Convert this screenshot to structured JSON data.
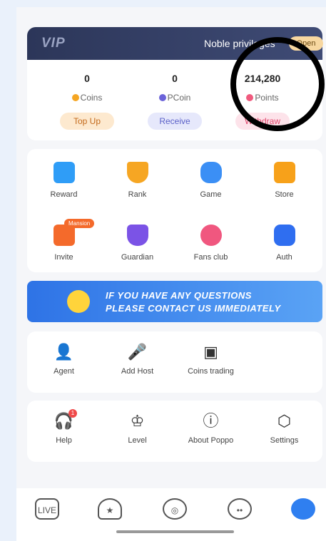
{
  "vip": {
    "logo": "VIP",
    "title": "Noble privileges",
    "open_label": "Open"
  },
  "assets": [
    {
      "value": "0",
      "label": "Coins",
      "button": "Top Up",
      "color": "#f5a623",
      "btn_bg": "#fde9cf",
      "btn_fg": "#c46a1b"
    },
    {
      "value": "0",
      "label": "PCoin",
      "button": "Receive",
      "color": "#6b63d9",
      "btn_bg": "#e6e8fb",
      "btn_fg": "#5a5fc8"
    },
    {
      "value": "214,280",
      "label": "Points",
      "button": "Withdraw",
      "color": "#f05a7e",
      "btn_bg": "#fde3ea",
      "btn_fg": "#e0456b"
    }
  ],
  "grid": [
    {
      "label": "Reward",
      "icon": "reward-icon",
      "color": "#2f9df7"
    },
    {
      "label": "Rank",
      "icon": "trophy-icon",
      "color": "#f6a623"
    },
    {
      "label": "Game",
      "icon": "gamepad-icon",
      "color": "#3b8ff5"
    },
    {
      "label": "Store",
      "icon": "bag-icon",
      "color": "#f7a11a"
    },
    {
      "label": "Invite",
      "icon": "envelope-icon",
      "color": "#f46a2b",
      "badge": "Mansion"
    },
    {
      "label": "Guardian",
      "icon": "shield-icon",
      "color": "#7b53e6"
    },
    {
      "label": "Fans club",
      "icon": "heart-icon",
      "color": "#f0577f"
    },
    {
      "label": "Auth",
      "icon": "verified-icon",
      "color": "#2f6ef0"
    }
  ],
  "banner": {
    "line1": "IF YOU HAVE ANY QUESTIONS",
    "line2": "PLEASE CONTACT US IMMEDIATELY",
    "icon": "headset-icon"
  },
  "tools": [
    {
      "label": "Agent",
      "icon": "agent-icon",
      "glyph": "👤"
    },
    {
      "label": "Add Host",
      "icon": "microphone-icon",
      "glyph": "🎤"
    },
    {
      "label": "Coins trading",
      "icon": "wallet-icon",
      "glyph": "▣"
    }
  ],
  "more": [
    {
      "label": "Help",
      "icon": "help-headset-icon",
      "glyph": "🎧",
      "badge": "1"
    },
    {
      "label": "Level",
      "icon": "crown-icon",
      "glyph": "♔"
    },
    {
      "label": "About Poppo",
      "icon": "info-icon",
      "glyph": "ⓘ"
    },
    {
      "label": "Settings",
      "icon": "settings-icon",
      "glyph": "⬡"
    }
  ],
  "nav": [
    {
      "label": "LIVE",
      "icon": "live-tv-icon"
    },
    {
      "label": "★",
      "icon": "home-star-icon"
    },
    {
      "label": "◎",
      "icon": "compass-icon"
    },
    {
      "label": "••",
      "icon": "chat-icon"
    },
    {
      "label": "",
      "icon": "profile-icon"
    }
  ]
}
